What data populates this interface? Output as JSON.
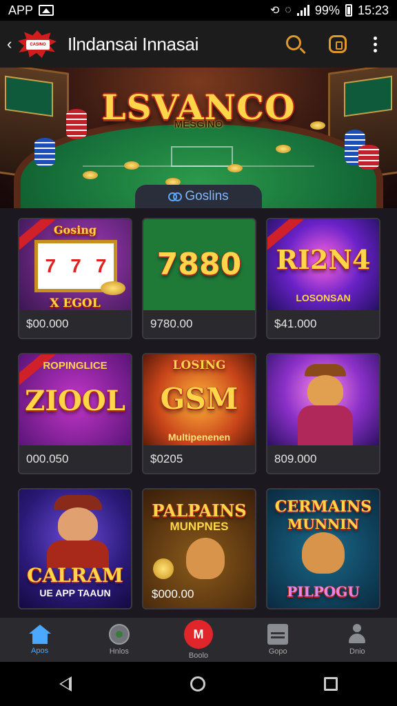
{
  "status_bar": {
    "left_label": "APP",
    "battery": "99%",
    "time": "15:23"
  },
  "header": {
    "logo_text": "CASINO",
    "title": "Ilndansai Innasai",
    "icons": [
      "back-icon",
      "search-icon",
      "coin-icon",
      "more-icon"
    ]
  },
  "hero": {
    "title": "LSVANCO",
    "subtitle": "MESGINO",
    "tab_label": "Goslins"
  },
  "games": [
    {
      "art_title": "Gosing",
      "art_sub": "X EGOL",
      "caption": "$00.000"
    },
    {
      "art_title": "7880",
      "art_sub": "",
      "caption": "9780.00"
    },
    {
      "art_title": "RI2N4",
      "art_sub": "LOSONSAN",
      "caption": "$41.000"
    },
    {
      "art_title": "ZIOOL",
      "art_sub": "ROPINGLICE",
      "caption": "000.050"
    },
    {
      "art_title": "GSM",
      "art_sub": "Multipenenen",
      "top": "LOSING",
      "caption": "$0205"
    },
    {
      "art_title": "",
      "art_sub": "",
      "caption": "809.000"
    },
    {
      "art_title": "CALRAM",
      "art_sub": "UE APP TAAUN",
      "caption": ""
    },
    {
      "art_title": "PALPAINS",
      "art_sub": "MUNPNES",
      "caption": "$000.00"
    },
    {
      "art_title": "CERMAINS",
      "art_sub": "MUNNIN",
      "bottom": "PILPOGU",
      "caption": ""
    }
  ],
  "bottom_nav": [
    {
      "label": "Apos",
      "icon": "home-icon",
      "active": true
    },
    {
      "label": "Hnlos",
      "icon": "gamepad-icon",
      "active": false
    },
    {
      "label": "Boolo",
      "icon": "casino-icon",
      "active": false
    },
    {
      "label": "Gopo",
      "icon": "document-icon",
      "active": false
    },
    {
      "label": "Dnio",
      "icon": "profile-icon",
      "active": false
    }
  ],
  "colors": {
    "accent": "#e09a2c",
    "active_nav": "#4aa8ff",
    "header_bg": "#1c1c1c",
    "grid_bg": "#1b1820"
  }
}
